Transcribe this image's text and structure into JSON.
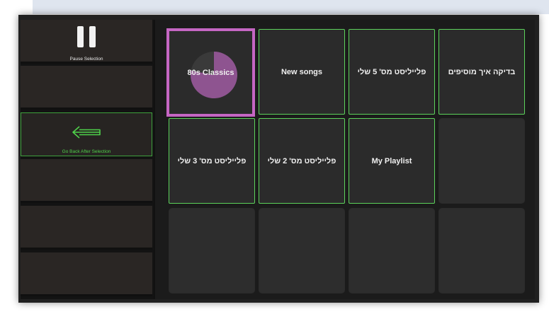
{
  "sidebar": {
    "pause_label": "Pause Selection",
    "go_back_label": "Go Back After Selection"
  },
  "tiles": [
    {
      "label": "80s Classics",
      "selected": true,
      "progress": 0.78
    },
    {
      "label": "New songs"
    },
    {
      "label": "פלייליסט מס' 5 שלי"
    },
    {
      "label": "בדיקה איך מוסיפים"
    },
    {
      "label": "פלייליסט מס' 3 שלי"
    },
    {
      "label": "פלייליסט מס' 2 שלי"
    },
    {
      "label": "My Playlist"
    }
  ],
  "colors": {
    "playlist_border": "#5cd35b",
    "selection_border": "#c566c3",
    "progress_fill": "#8e5490",
    "go_back_accent": "#4fd14a"
  },
  "icons": {
    "pause": "pause-icon",
    "go_back": "arrow-left-icon",
    "progress": "dwell-progress-icon"
  }
}
